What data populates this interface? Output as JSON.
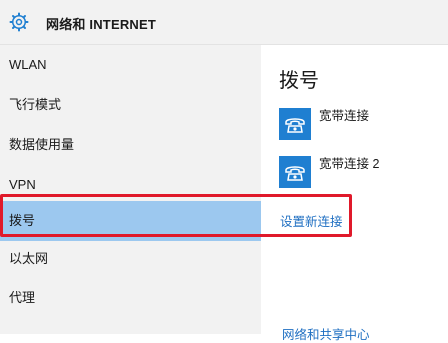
{
  "header": {
    "title": "网络和 INTERNET",
    "icon": "gear-icon"
  },
  "sidebar": {
    "items": [
      {
        "label": "WLAN"
      },
      {
        "label": "飞行模式"
      },
      {
        "label": "数据使用量"
      },
      {
        "label": "VPN"
      },
      {
        "label": "拨号",
        "selected": true
      },
      {
        "label": "以太网"
      },
      {
        "label": "代理"
      }
    ]
  },
  "main": {
    "title": "拨号",
    "connections": [
      {
        "label": "宽带连接",
        "icon": "phone-connection-icon"
      },
      {
        "label": "宽带连接 2",
        "icon": "phone-connection-icon"
      }
    ],
    "setup_link": "设置新连接",
    "bottom_link": "网络和共享中心"
  },
  "colors": {
    "accent": "#1f7fd1",
    "selected_bg": "#9cc8ef",
    "link": "#1f6fc2",
    "highlight_border": "#e0192a"
  }
}
